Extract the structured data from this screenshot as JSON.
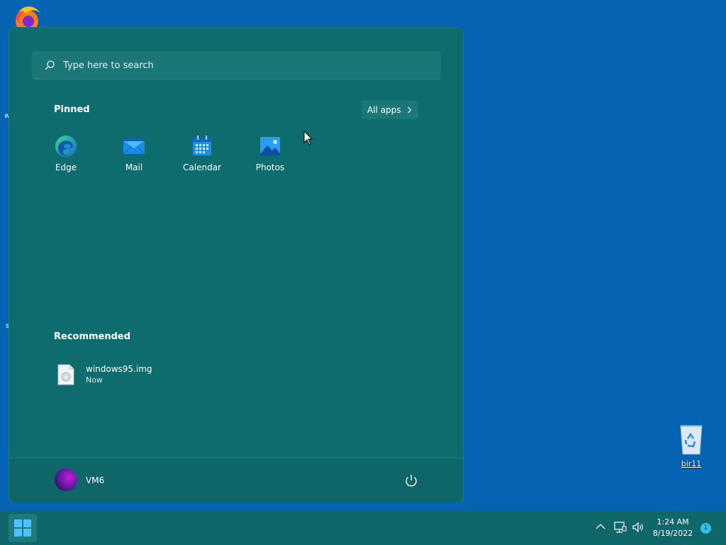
{
  "desktop": {
    "recycle_bin_label": "bir11",
    "left_fragment_1": "w",
    "left_fragment_2": "s"
  },
  "start_menu": {
    "search": {
      "placeholder": "Type here to search"
    },
    "pinned": {
      "title": "Pinned",
      "all_apps_label": "All apps",
      "apps": [
        {
          "label": "Edge",
          "icon": "edge-icon"
        },
        {
          "label": "Mail",
          "icon": "mail-icon"
        },
        {
          "label": "Calendar",
          "icon": "calendar-icon"
        },
        {
          "label": "Photos",
          "icon": "photos-icon"
        }
      ]
    },
    "recommended": {
      "title": "Recommended",
      "items": [
        {
          "name": "windows95.img",
          "time": "Now",
          "icon": "disc-image-file-icon"
        }
      ]
    },
    "footer": {
      "user_name": "VM6"
    }
  },
  "taskbar": {
    "clock_time": "1:24 AM",
    "clock_date": "8/19/2022",
    "notification_count": "1"
  },
  "colors": {
    "desktop_bg": "#0563b4",
    "menu_bg": "#0f6c6e",
    "taskbar_bg": "#0f6769"
  }
}
